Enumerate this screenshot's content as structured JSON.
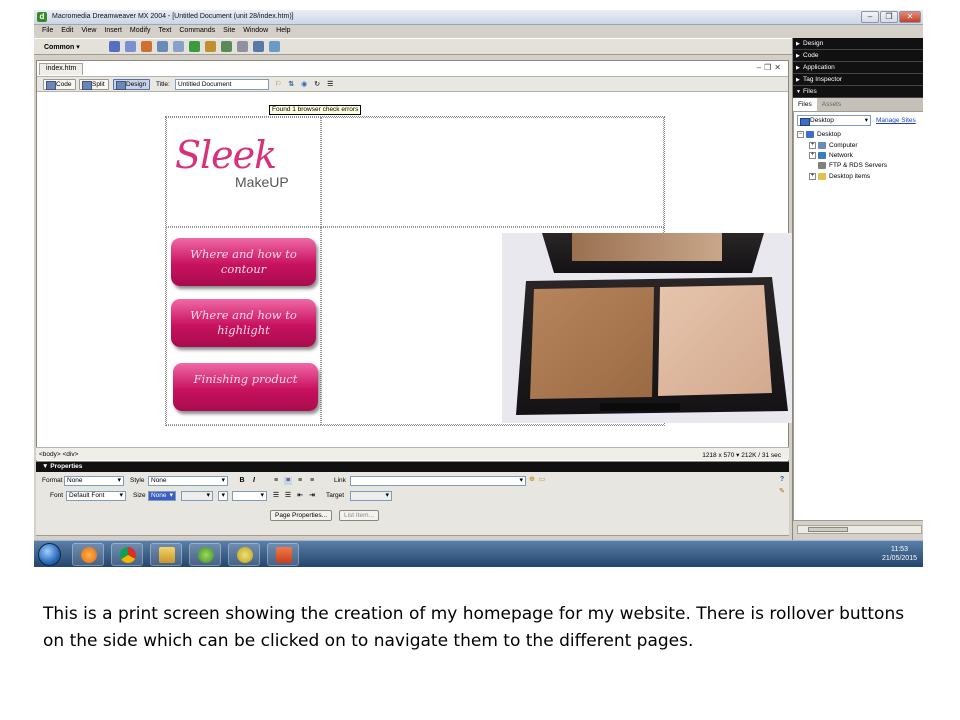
{
  "window": {
    "title": "Macromedia Dreamweaver MX 2004 - [Untitled Document (unit 28/index.htm)]"
  },
  "menu": [
    "File",
    "Edit",
    "View",
    "Insert",
    "Modify",
    "Text",
    "Commands",
    "Site",
    "Window",
    "Help"
  ],
  "insert_bar": {
    "category": "Common"
  },
  "document": {
    "tab": "index.htm",
    "views": {
      "code": "Code",
      "split": "Split",
      "design": "Design"
    },
    "title_label": "Title:",
    "title_value": "Untitled Document",
    "tooltip": "Found 1 browser check errors"
  },
  "page": {
    "logo": {
      "brand": "Sleek",
      "sub": "MakeUP"
    },
    "buttons": [
      {
        "label": "Where and how to contour"
      },
      {
        "label": "Where and how to highlight"
      },
      {
        "label": "Finishing product"
      }
    ]
  },
  "status": {
    "tags": "<body> <div>",
    "info": "1218 x 570 ▾ 212K / 31 sec"
  },
  "properties": {
    "header": "Properties",
    "format_label": "Format",
    "format_value": "None",
    "style_label": "Style",
    "style_value": "None",
    "bold": "B",
    "italic": "I",
    "link_label": "Link",
    "font_label": "Font",
    "font_value": "Default Font",
    "size_label": "Size",
    "size_value": "None",
    "target_label": "Target",
    "page_properties": "Page Properties...",
    "list_item": "List Item..."
  },
  "panels": {
    "groups": [
      "Design",
      "Code",
      "Application",
      "Tag Inspector",
      "Files"
    ],
    "file_tabs": [
      "Files",
      "Assets"
    ],
    "site_select": "Desktop",
    "manage_sites": "Manage Sites",
    "tree": [
      "Desktop",
      "Computer",
      "Network",
      "FTP & RDS Servers",
      "Desktop items"
    ]
  },
  "taskbar": {
    "time": "11:53",
    "date": "21/05/2015"
  },
  "caption": "This is a print screen showing the creation of my homepage for my website. There is rollover buttons on the side which can be clicked on to navigate them to the different pages.",
  "colors": {
    "brand_pink": "#d8317a",
    "button_pink": "#c8125f"
  }
}
